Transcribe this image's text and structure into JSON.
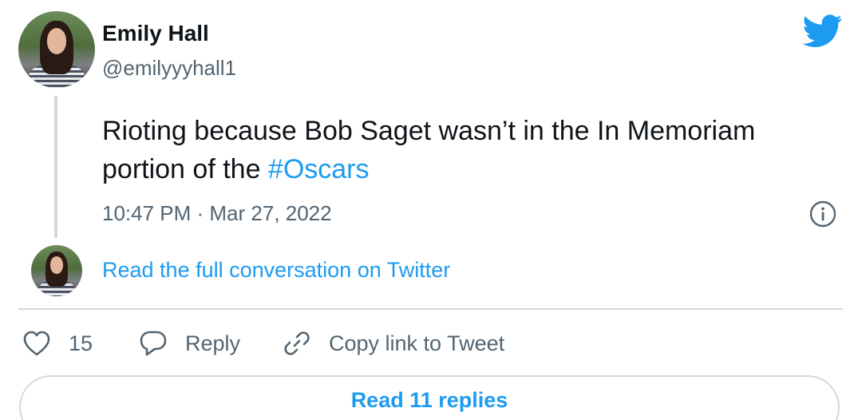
{
  "author": {
    "name": "Emily Hall",
    "handle": "@emilyyyhall1"
  },
  "tweet": {
    "text": "Rioting because Bob Saget wasn’t in the In Memoriam portion of the ",
    "hashtag": "#Oscars",
    "timestamp": "10:47 PM · Mar 27, 2022"
  },
  "conversation_link": "Read the full conversation on Twitter",
  "actions": {
    "like_count": "15",
    "reply_label": "Reply",
    "copy_label": "Copy link to Tweet"
  },
  "replies_button": "Read 11 replies",
  "colors": {
    "brand_blue": "#1d9bf0",
    "muted_text": "#536471",
    "border": "#cfd9de"
  },
  "icons": [
    "twitter-bird-icon",
    "info-icon",
    "heart-icon",
    "reply-bubble-icon",
    "link-icon"
  ]
}
